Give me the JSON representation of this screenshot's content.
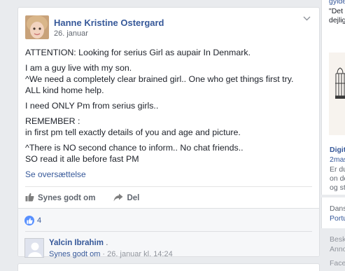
{
  "post": {
    "author": "Hanne Kristine Ostergard",
    "date": "26. januar",
    "paragraphs": [
      [
        "ATTENTION: Looking for serius Girl as aupair In Denmark."
      ],
      [
        "I am a guy live with my son.",
        "^We need a completely clear brained girl.. One who get things first try.",
        "ALL kind home help."
      ],
      [
        "I need ONLY Pm from serius girls.."
      ],
      [
        "REMEMBER :",
        "in first pm tell exactly details of you and age and picture."
      ],
      [
        "^There is NO second chance to inform.. No chat friends..",
        "SO read it alle before fast PM"
      ]
    ],
    "translate_link": "Se oversættelse",
    "actions": {
      "like": "Synes godt om",
      "share": "Del"
    },
    "like_count": "4"
  },
  "comment": {
    "author": "Yalcin Ibrahim",
    "author_suffix": ".",
    "like_link": "Synes godt om",
    "separator": " · ",
    "timestamp": "26. januar kl. 14:24"
  },
  "right_column": {
    "top_link": "gylde",
    "top_text_1": "\"Det",
    "top_text_2": "dejlig",
    "ad_title": "Digit",
    "ad_sub_1": "2mas",
    "ad_sub_2": "Er du",
    "ad_sub_3": "on de",
    "ad_sub_4": "og sti",
    "lang_label": "Dans",
    "lang_link": "Portu",
    "footer_1": "Besk",
    "footer_2": "Anno",
    "footer_3": "Face"
  },
  "colors": {
    "link": "#365899",
    "text": "#1d2129",
    "meta": "#616770",
    "like_blue": "#5890ff",
    "background": "#e9ebee"
  }
}
